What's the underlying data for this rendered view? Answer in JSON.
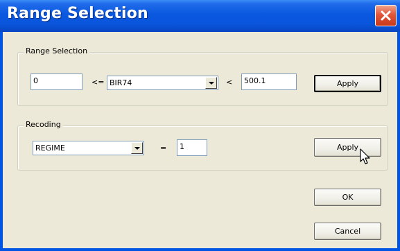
{
  "window": {
    "title": "Range Selection"
  },
  "range_group": {
    "label": "Range Selection",
    "lower_value": "0",
    "lower_op": "<=",
    "variable": "BIR74",
    "upper_op": "<",
    "upper_value": "500.1",
    "apply_label": "Apply"
  },
  "recoding_group": {
    "label": "Recoding",
    "variable": "REGIME",
    "op": "=",
    "value": "1",
    "apply_label": "Apply"
  },
  "buttons": {
    "ok_label": "OK",
    "cancel_label": "Cancel"
  },
  "icons": {
    "close": "close-icon",
    "cursor": "mouse-pointer-icon",
    "dropdown": "chevron-down-icon"
  },
  "colors": {
    "titlebar": "#0a58e0",
    "close": "#e2563a",
    "face": "#ece9d8"
  }
}
